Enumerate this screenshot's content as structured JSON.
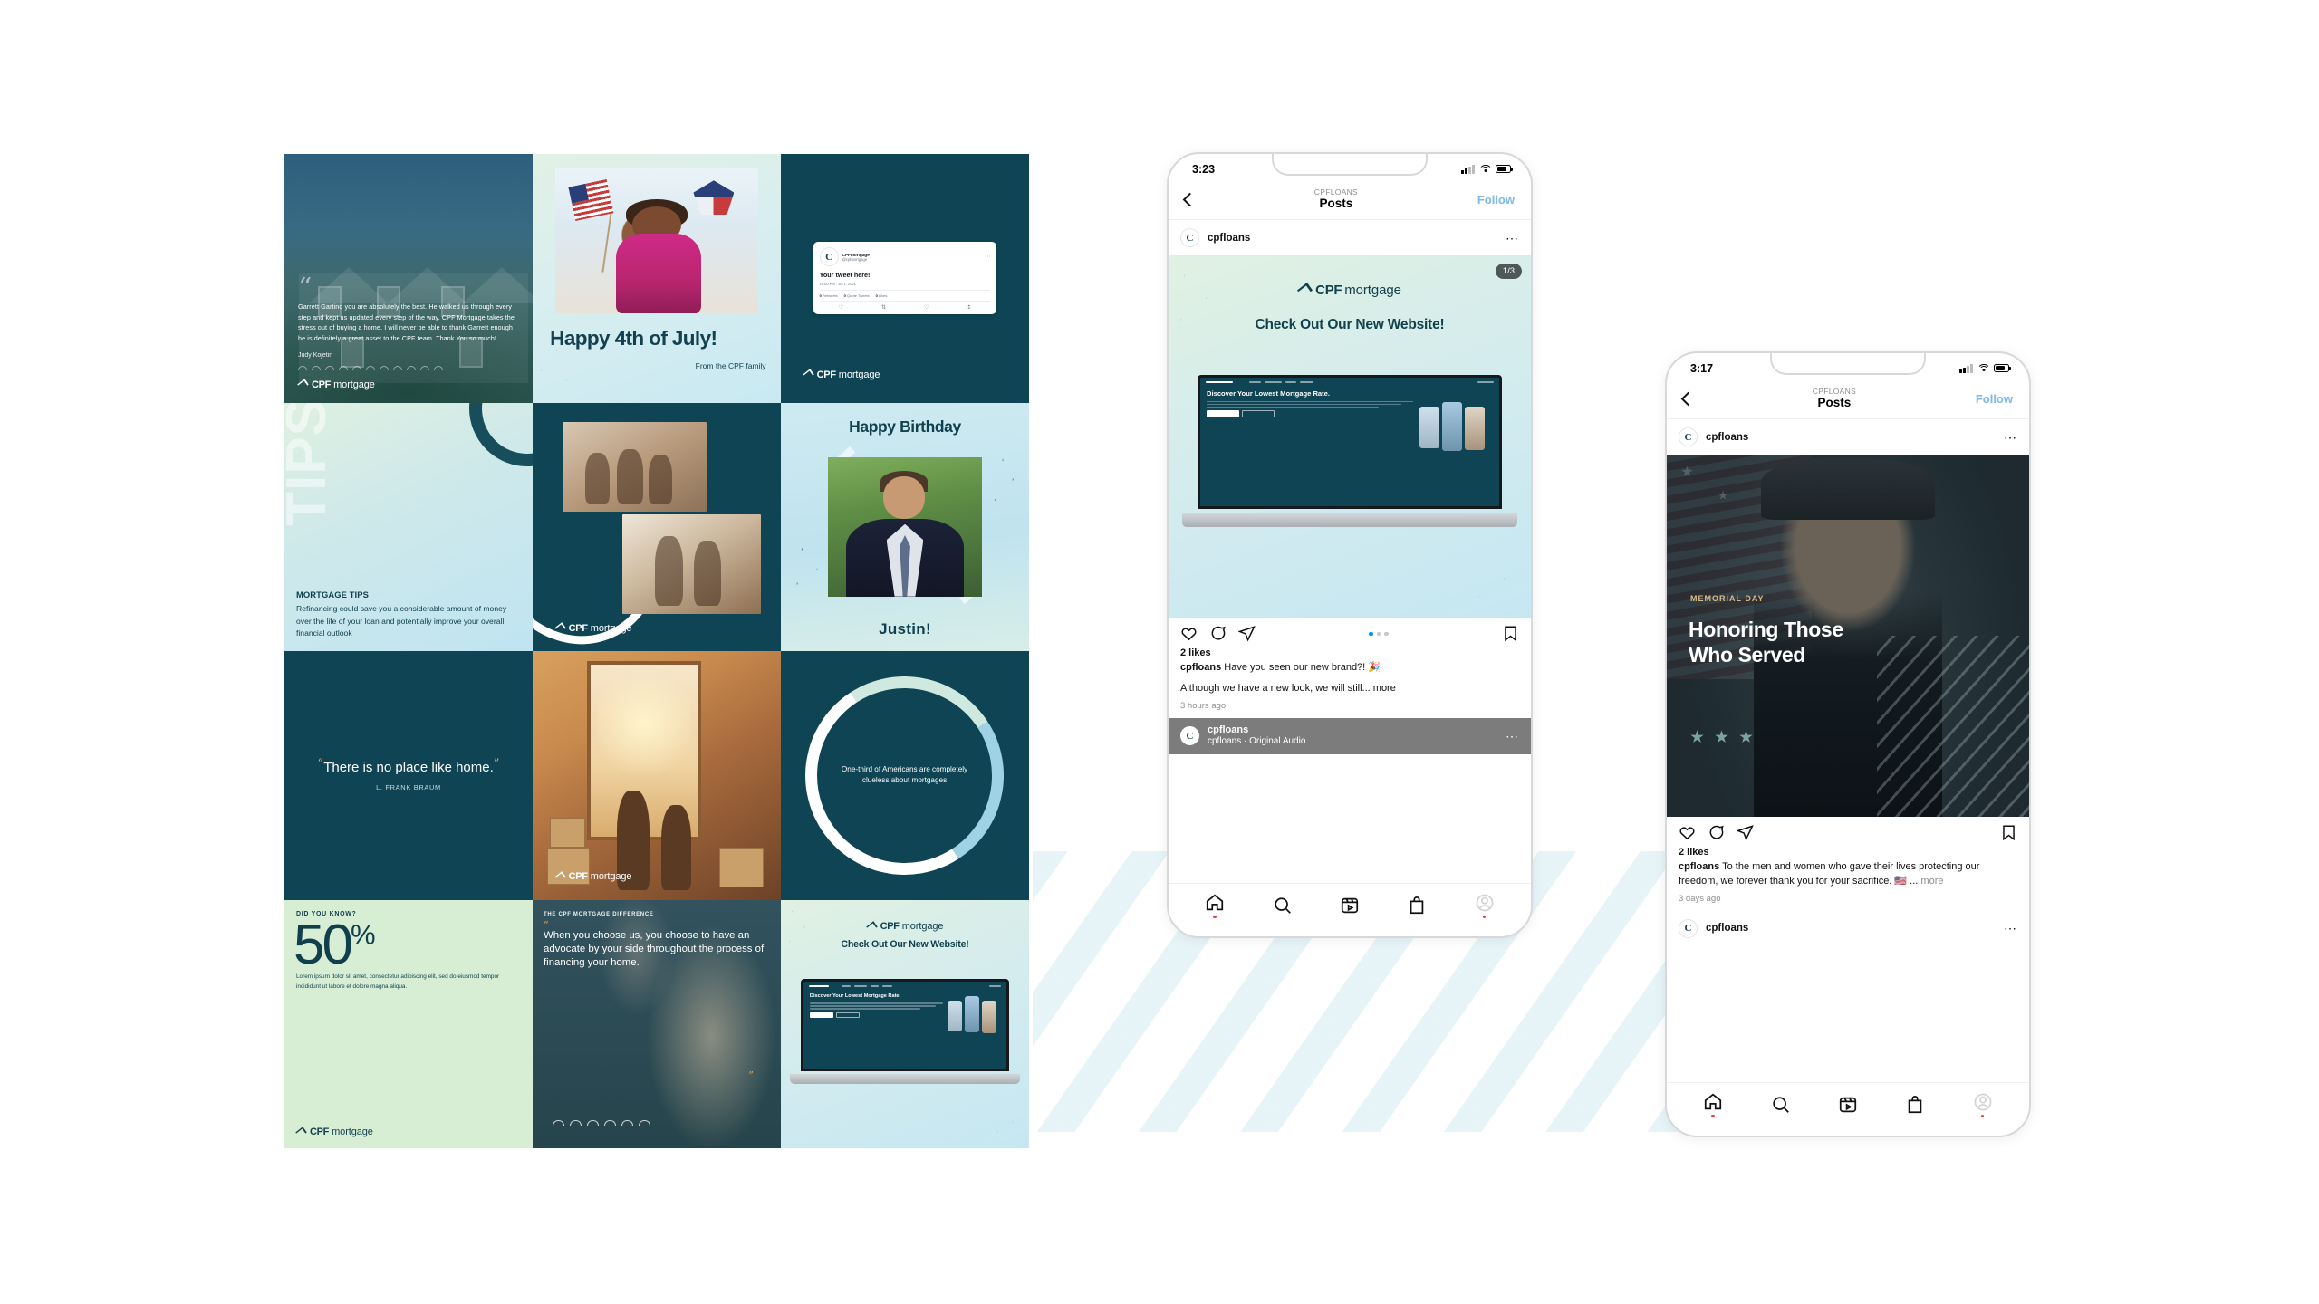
{
  "brand": {
    "name_bold": "CPF",
    "name_light": "mortgage",
    "teal": "#0e4454",
    "accent_orange": "#e8a35c",
    "light_blue": "#c9e9f2",
    "mint": "#d7eed5"
  },
  "grid": {
    "testimonial": {
      "quote": "Garrett Gartino you are absolutely the best. He walked us through every step and kept us updated every step of the way. CPF Mortgage takes the stress out of buying a home. I will never be able to thank Garrett enough he is definitely a great asset to the CPF team. Thank You so much!",
      "author": "Judy Kojetin",
      "logo_bold": "CPF",
      "logo_light": "mortgage"
    },
    "july": {
      "title": "Happy 4th of July!",
      "subtitle": "From the CPF family"
    },
    "tweet": {
      "account_name": "CPFmortgage",
      "handle": "@cpfmortgage",
      "text": "Your tweet here!",
      "timestamp": "10:00 PM · Jul 1, 2021",
      "stat_retweets_count": "0",
      "stat_retweets_label": "Retweets",
      "stat_quotes_count": "0",
      "stat_quotes_label": "Quote Tweets",
      "stat_likes_count": "0",
      "stat_likes_label": "Likes",
      "logo_bold": "CPF",
      "logo_light": "mortgage"
    },
    "tips": {
      "watermark": "TIPS",
      "heading": "MORTGAGE TIPS",
      "body": "Refinancing could save you a considerable amount of money over the life of your loan and potentially improve your overall financial outlook"
    },
    "family": {
      "logo_bold": "CPF",
      "logo_light": "mortgage"
    },
    "birthday": {
      "title": "Happy Birthday",
      "name": "Justin!"
    },
    "quote": {
      "open_quote": "“",
      "text": "There is no place like home.",
      "close_quote": "”",
      "author": "L. FRANK BRAUM"
    },
    "moving": {
      "logo_bold": "CPF",
      "logo_light": "mortgage"
    },
    "circle": {
      "stat_text": "One-third of Americans are completely clueless about mortgages"
    },
    "fifty": {
      "kicker": "DID YOU KNOW?",
      "number": "50",
      "symbol": "%",
      "body": "Lorem ipsum dolor sit amet, consectetur adipiscing elit, sed do eiusmod tempor incididunt ut labore et dolore magna aliqua.",
      "logo_bold": "CPF",
      "logo_light": "mortgage"
    },
    "difference": {
      "kicker": "THE CPF MORTGAGE DIFFERENCE",
      "open_quote": "“",
      "text": "When you choose us, you choose to have an advocate by your side throughout the process of financing your home.",
      "close_quote": "”"
    },
    "website": {
      "logo_bold": "CPF",
      "logo_light": "mortgage",
      "heading": "Check Out Our New Website!",
      "laptop_headline": "Discover Your Lowest Mortgage Rate."
    }
  },
  "phone1": {
    "status": {
      "time": "3:23"
    },
    "header": {
      "kicker": "CPFLOANS",
      "title": "Posts",
      "follow": "Follow"
    },
    "post": {
      "username": "cpfloans",
      "carousel_badge": "1/3",
      "media_logo_bold": "CPF",
      "media_logo_light": "mortgage",
      "media_heading": "Check Out Our New Website!",
      "laptop_headline": "Discover Your Lowest Mortgage Rate.",
      "likes": "2 likes",
      "caption_user": "cpfloans",
      "caption_line1": "Have you seen our new brand?! 🎉",
      "caption_line2": "Although we have a new look, we will still...",
      "more": "more",
      "timeago": "3 hours ago"
    },
    "audio": {
      "title": "cpfloans",
      "subtitle": "cpfloans · Original Audio"
    },
    "tabs": [
      "home-icon",
      "search-icon",
      "reels-icon",
      "shop-icon",
      "profile-icon"
    ]
  },
  "phone2": {
    "status": {
      "time": "3:17"
    },
    "header": {
      "kicker": "CPFLOANS",
      "title": "Posts",
      "follow": "Follow"
    },
    "post": {
      "username": "cpfloans",
      "media_kicker": "MEMORIAL DAY",
      "media_title_line1": "Honoring Those",
      "media_title_line2": "Who Served",
      "likes": "2 likes",
      "caption_user": "cpfloans",
      "caption_text": "To the men and women who gave their lives protecting our freedom, we forever thank you for your sacrifice. 🇺🇸 ...",
      "more": "more",
      "timeago": "3 days ago"
    },
    "next_post_username": "cpfloans",
    "tabs": [
      "home-icon",
      "search-icon",
      "reels-icon",
      "shop-icon",
      "profile-icon"
    ]
  }
}
